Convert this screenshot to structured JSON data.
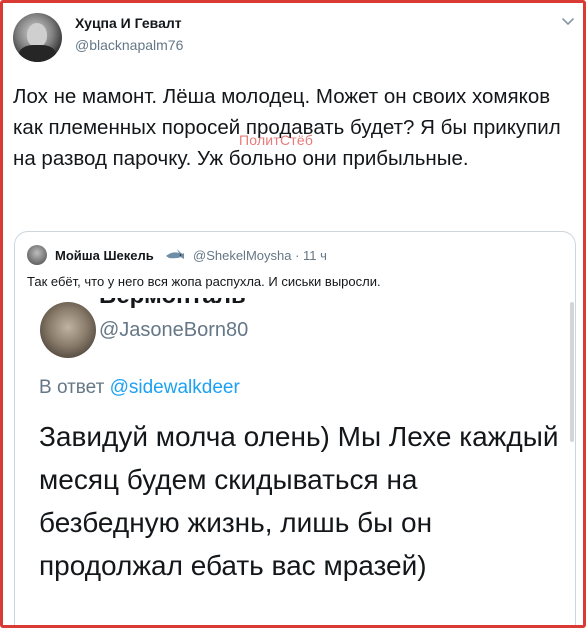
{
  "tweet": {
    "author_name": "Хуцпа И Гевалт",
    "author_handle": "@blacknapalm76",
    "text": "Лох не мамонт. Лёша молодец. Может он своих хомяков как племенных поросей продавать будет? Я бы прикупил на развод парочку. Уж больно они прибыльные.",
    "menu_icon": "chevron-down-icon"
  },
  "watermark": "ПолитСтёб",
  "quote": {
    "author_name": "Мойша Шекель",
    "badge_icon": "shark-emoji-icon",
    "handle_time": "@ShekelMoysha · 11 ч",
    "text": "Так ебёт, что у него вся жопа распухла. И сиськи выросли."
  },
  "screenshot": {
    "cut_name": "Вермонталь",
    "handle": "@JasoneBorn80",
    "reply_prefix": "В ответ",
    "reply_mention": "@sidewalkdeer",
    "body": "Завидуй молча олень) Мы Лехе каждый месяц будем скидываться на безбедную жизнь, лишь бы он продолжал ебать вас мразей)"
  },
  "colors": {
    "frame_border": "#d93a34",
    "text": "#14171a",
    "secondary": "#657786",
    "link": "#1da1f2",
    "watermark": "#e87a7a"
  }
}
